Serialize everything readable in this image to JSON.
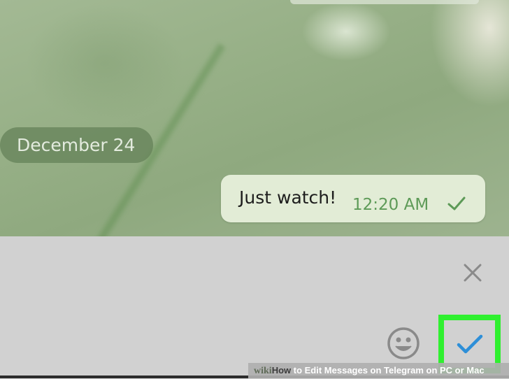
{
  "chat": {
    "date_label": "December 24",
    "message": {
      "text": "Just watch!",
      "time": "12:20 AM",
      "status_icon": "check-icon"
    }
  },
  "editor": {
    "close_icon": "close-icon",
    "emoji_icon": "emoji-icon",
    "save_icon": "check-icon",
    "save_highlight_color": "#2ff02f"
  },
  "watermark": {
    "brand": "wiki",
    "how": "How",
    "title": " to Edit Messages on Telegram on PC or Mac"
  },
  "colors": {
    "time_text": "#5d9a57",
    "save_check": "#2e8fd8",
    "panel_background": "#d1d1d1"
  }
}
